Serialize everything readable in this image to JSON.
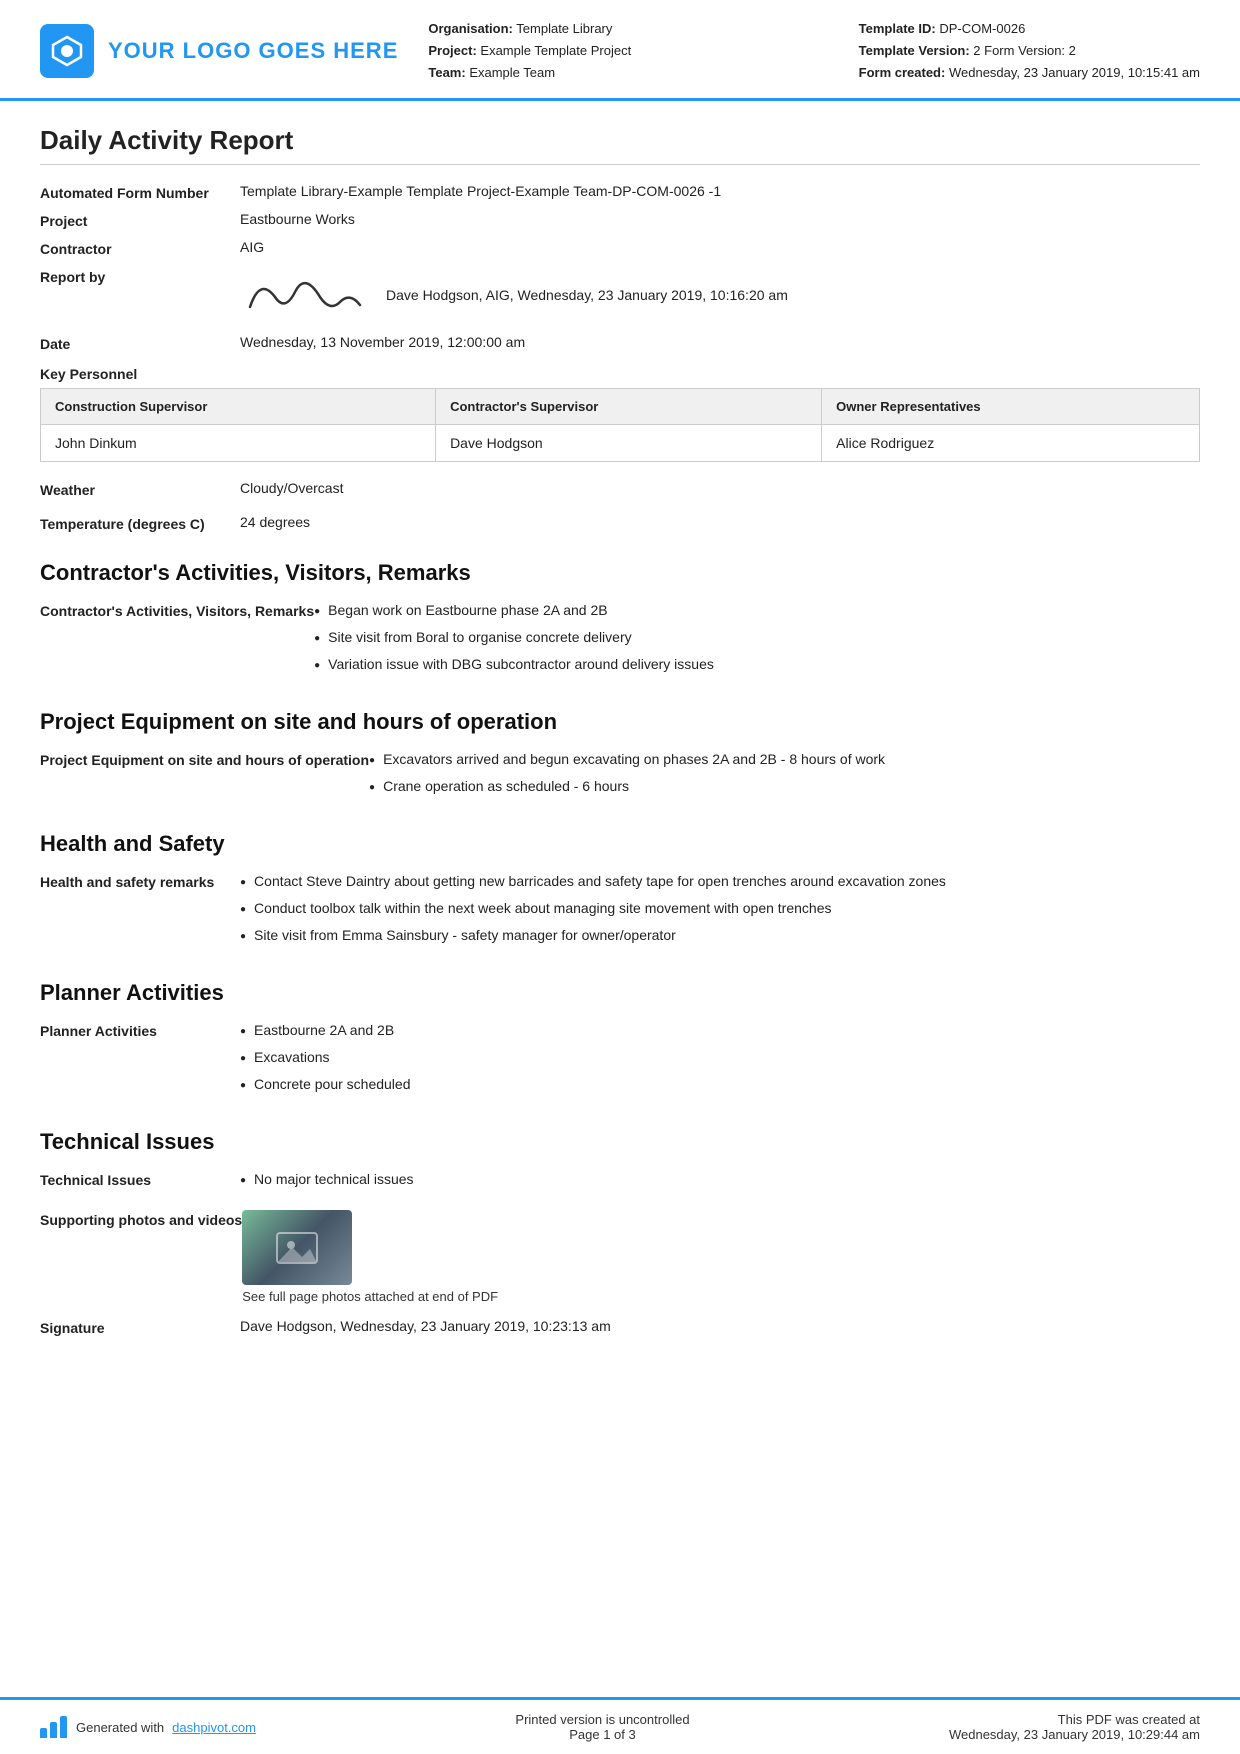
{
  "header": {
    "logo_text": "YOUR LOGO GOES HERE",
    "org_label": "Organisation:",
    "org_value": "Template Library",
    "project_label": "Project:",
    "project_value": "Example Template Project",
    "team_label": "Team:",
    "team_value": "Example Team",
    "template_id_label": "Template ID:",
    "template_id_value": "DP-COM-0026",
    "template_version_label": "Template Version:",
    "template_version_value": "2 Form Version: 2",
    "form_created_label": "Form created:",
    "form_created_value": "Wednesday, 23 January 2019, 10:15:41 am"
  },
  "report": {
    "title": "Daily Activity Report",
    "form_number_label": "Automated Form Number",
    "form_number_value": "Template Library-Example Template Project-Example Team-DP-COM-0026  -1",
    "project_label": "Project",
    "project_value": "Eastbourne Works",
    "contractor_label": "Contractor",
    "contractor_value": "AIG",
    "report_by_label": "Report by",
    "report_by_text": "Dave Hodgson, AIG, Wednesday, 23 January 2019, 10:16:20 am",
    "date_label": "Date",
    "date_value": "Wednesday, 13 November 2019, 12:00:00 am",
    "key_personnel_label": "Key Personnel",
    "personnel_table": {
      "headers": [
        "Construction Supervisor",
        "Contractor's Supervisor",
        "Owner Representatives"
      ],
      "rows": [
        [
          "John Dinkum",
          "Dave Hodgson",
          "Alice Rodriguez"
        ]
      ]
    },
    "weather_label": "Weather",
    "weather_value": "Cloudy/Overcast",
    "temperature_label": "Temperature (degrees C)",
    "temperature_value": "24 degrees"
  },
  "sections": {
    "contractors_activities": {
      "heading": "Contractor's Activities, Visitors, Remarks",
      "label": "Contractor's Activities, Visitors, Remarks",
      "items": [
        "Began work on Eastbourne phase 2A and 2B",
        "Site visit from Boral to organise concrete delivery",
        "Variation issue with DBG subcontractor around delivery issues"
      ]
    },
    "project_equipment": {
      "heading": "Project Equipment on site and hours of operation",
      "label": "Project Equipment on site and hours of operation",
      "items": [
        "Excavators arrived and begun excavating on phases 2A and 2B - 8 hours of work",
        "Crane operation as scheduled - 6 hours"
      ]
    },
    "health_safety": {
      "heading": "Health and Safety",
      "label": "Health and safety remarks",
      "items": [
        "Contact Steve Daintry about getting new barricades and safety tape for open trenches around excavation zones",
        "Conduct toolbox talk within the next week about managing site movement with open trenches",
        "Site visit from Emma Sainsbury - safety manager for owner/operator"
      ]
    },
    "planner_activities": {
      "heading": "Planner Activities",
      "label": "Planner Activities",
      "items": [
        "Eastbourne 2A and 2B",
        "Excavations",
        "Concrete pour scheduled"
      ]
    },
    "technical_issues": {
      "heading": "Technical Issues",
      "label": "Technical Issues",
      "items": [
        "No major technical issues"
      ],
      "supporting_label": "Supporting photos and videos",
      "photo_caption": "See full page photos attached at end of PDF",
      "signature_label": "Signature",
      "signature_value": "Dave Hodgson, Wednesday, 23 January 2019, 10:23:13 am"
    }
  },
  "footer": {
    "generated_text": "Generated with ",
    "link_text": "dashpivot.com",
    "center_line1": "Printed version is uncontrolled",
    "center_line2": "Page 1 of 3",
    "right_line1": "This PDF was created at",
    "right_line2": "Wednesday, 23 January 2019, 10:29:44 am"
  }
}
